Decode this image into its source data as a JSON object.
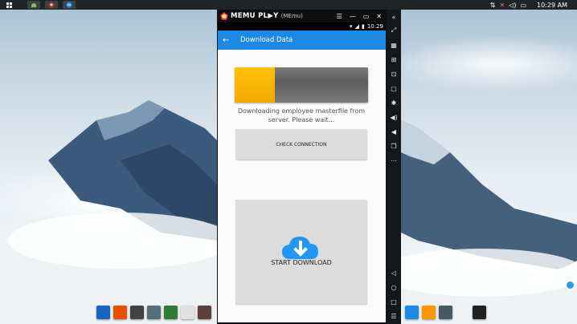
{
  "topbar": {
    "clock": "10:29 AM"
  },
  "emulator": {
    "brand": "MEMU PL▶Y",
    "instance": "(MEmu)"
  },
  "android": {
    "status_time": "10:29",
    "app_title": "Download Data",
    "progress": 0.3,
    "status_message": "Downloading employee masterfile from server. Please wait...",
    "check_connection_label": "CHECK CONNECTION",
    "start_download_label": "START DOWNLOAD"
  },
  "colors": {
    "app_bar": "#1e88e5",
    "progress_fill": "#ffc107",
    "cloud_icon": "#2196f3"
  },
  "icons": {
    "side_toolbar": [
      "collapse-icon",
      "fullscreen-icon",
      "keyboard-icon",
      "screenshot-icon",
      "multi-window-icon",
      "recorder-icon",
      "settings-icon",
      "volume-up-icon",
      "volume-down-icon",
      "copy-icon",
      "more-icon",
      "back-icon",
      "home-icon",
      "recents-icon",
      "menu-icon"
    ]
  }
}
